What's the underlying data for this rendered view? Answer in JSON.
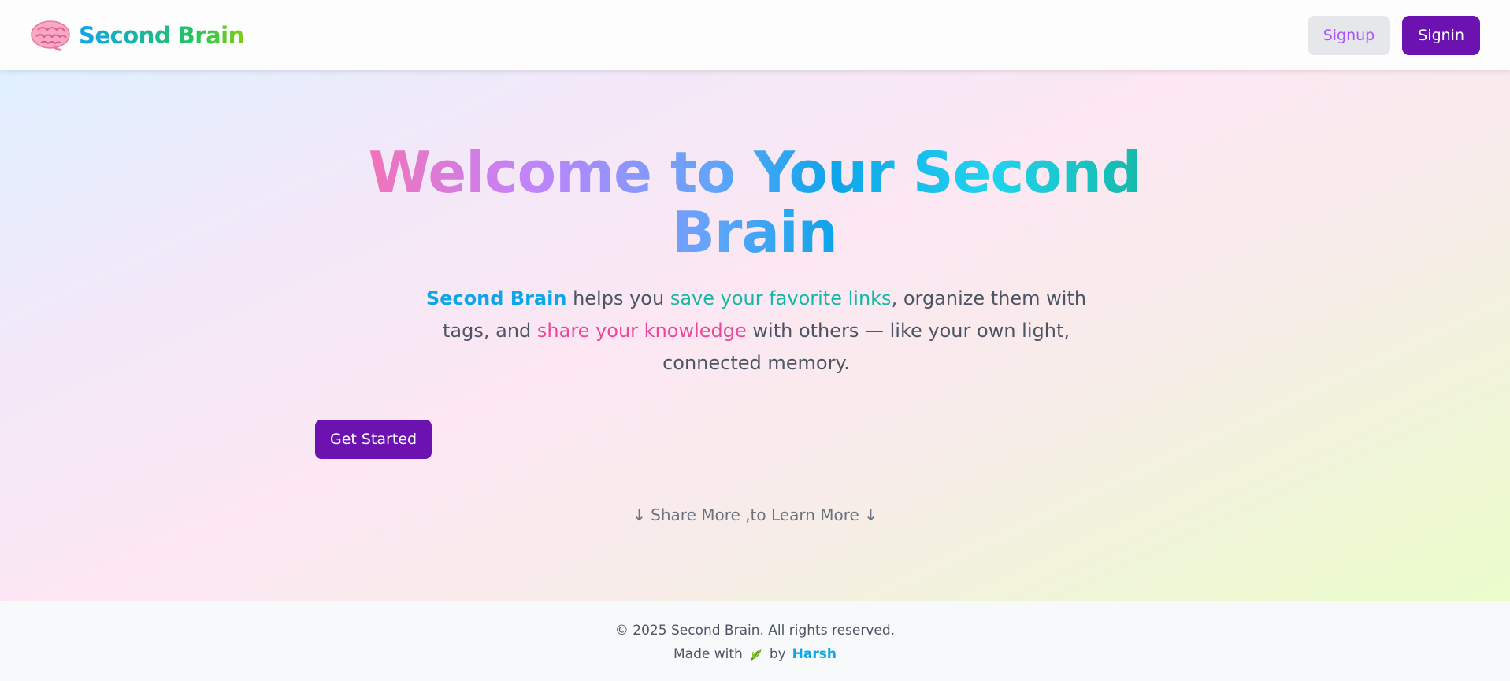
{
  "navbar": {
    "brand_name": "Second Brain",
    "brand_icon": "brain-icon",
    "signup_label": "Signup",
    "signin_label": "Signin"
  },
  "hero": {
    "title": "Welcome to Your Second Brain",
    "description": {
      "brand": "Second Brain",
      "part1": " helps you ",
      "links": "save your favorite links",
      "part2": ", organize them with tags, and ",
      "share": "share your knowledge",
      "part3": " with others — like your own light, connected memory."
    },
    "cta_label": "Get Started",
    "scroll_hint": "↓ Share More ,to Learn More ↓"
  },
  "footer": {
    "copyright": "© 2025 Second Brain. All rights reserved.",
    "made_with": "Made with",
    "made_icon": "leaf-icon",
    "by": "by",
    "author": "Harsh"
  },
  "colors": {
    "primary": "#6b12b0",
    "accent_blue": "#0ea5e9",
    "accent_teal": "#14b8a6",
    "accent_pink": "#ec4899"
  }
}
